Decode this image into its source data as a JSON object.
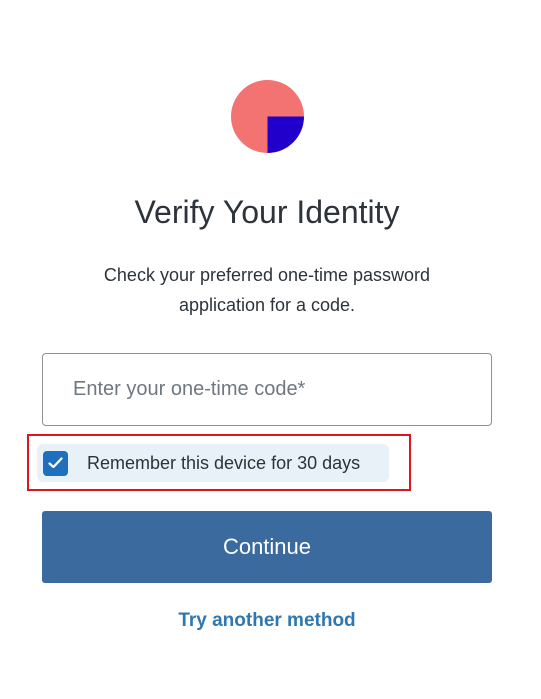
{
  "logo": {
    "icon": "brand-logo-icon",
    "colors": {
      "circle": "#f37272",
      "square": "#2200cc"
    }
  },
  "header": {
    "title": "Verify Your Identity",
    "subtitle": "Check your preferred one-time password application for a code."
  },
  "form": {
    "code_input": {
      "value": "",
      "placeholder": "Enter your one-time code*"
    },
    "remember": {
      "label": "Remember this device for 30 days",
      "checked": true,
      "icon": "checkmark-icon"
    },
    "continue_label": "Continue",
    "alternate_label": "Try another method"
  },
  "colors": {
    "primary_button": "#3a6a9e",
    "link": "#2f77b1",
    "checkbox": "#1f6fbf",
    "highlight_border": "#e0141e"
  }
}
